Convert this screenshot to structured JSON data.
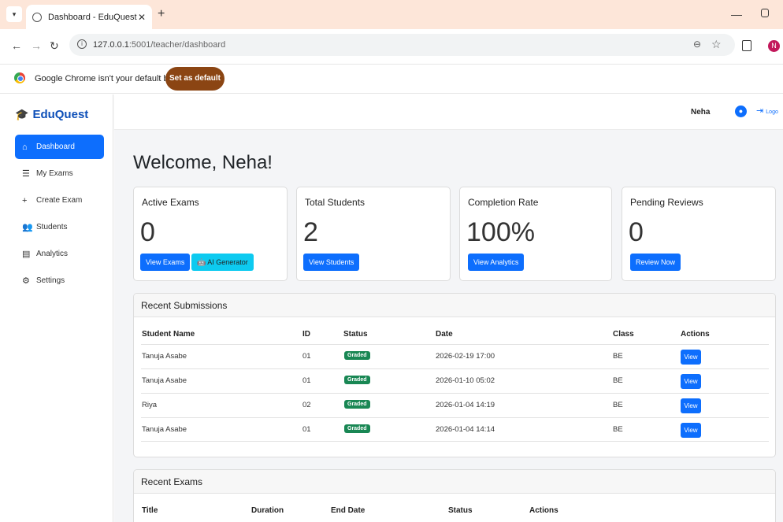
{
  "browser": {
    "tab_title": "Dashboard - EduQuest",
    "url_host": "127.0.0.1",
    "url_path": ":5001/teacher/dashboard",
    "infobar_text": "Google Chrome isn't your default browser",
    "set_default_label": "Set as default",
    "profile_initial": "N"
  },
  "app": {
    "brand": "EduQuest",
    "sidebar": [
      {
        "label": "Dashboard",
        "icon": "home-icon",
        "active": true
      },
      {
        "label": "My Exams",
        "icon": "list-icon",
        "active": false
      },
      {
        "label": "Create Exam",
        "icon": "plus-icon",
        "active": false
      },
      {
        "label": "Students",
        "icon": "users-icon",
        "active": false
      },
      {
        "label": "Analytics",
        "icon": "chart-icon",
        "active": false
      },
      {
        "label": "Settings",
        "icon": "gear-icon",
        "active": false
      }
    ],
    "user_name": "Neha",
    "logout_label": "Logo",
    "welcome": "Welcome, Neha!"
  },
  "cards": [
    {
      "title": "Active Exams",
      "value": "0",
      "buttons": [
        "View Exams",
        "🤖 AI Generator"
      ]
    },
    {
      "title": "Total Students",
      "value": "2",
      "buttons": [
        "View Students"
      ]
    },
    {
      "title": "Completion Rate",
      "value": "100%",
      "buttons": [
        "View Analytics"
      ]
    },
    {
      "title": "Pending Reviews",
      "value": "0",
      "buttons": [
        "Review Now"
      ]
    }
  ],
  "submissions": {
    "title": "Recent Submissions",
    "headers": [
      "Student Name",
      "ID",
      "Status",
      "Date",
      "Class",
      "Actions"
    ],
    "rows": [
      {
        "name": "Tanuja Asabe",
        "id": "01",
        "status": "Graded",
        "date": "2026-02-19 17:00",
        "class": "BE",
        "action": "View"
      },
      {
        "name": "Tanuja Asabe",
        "id": "01",
        "status": "Graded",
        "date": "2026-01-10 05:02",
        "class": "BE",
        "action": "View"
      },
      {
        "name": "Riya",
        "id": "02",
        "status": "Graded",
        "date": "2026-01-04 14:19",
        "class": "BE",
        "action": "View"
      },
      {
        "name": "Tanuja Asabe",
        "id": "01",
        "status": "Graded",
        "date": "2026-01-04 14:14",
        "class": "BE",
        "action": "View"
      }
    ]
  },
  "exams": {
    "title": "Recent Exams",
    "headers": [
      "Title",
      "Duration",
      "End Date",
      "Status",
      "Actions"
    ]
  },
  "colors": {
    "primary": "#0d6efd",
    "success": "#198754",
    "info": "#0dcaf0",
    "brand": "#0d4fb8",
    "set_default_bg": "#8b4513"
  }
}
